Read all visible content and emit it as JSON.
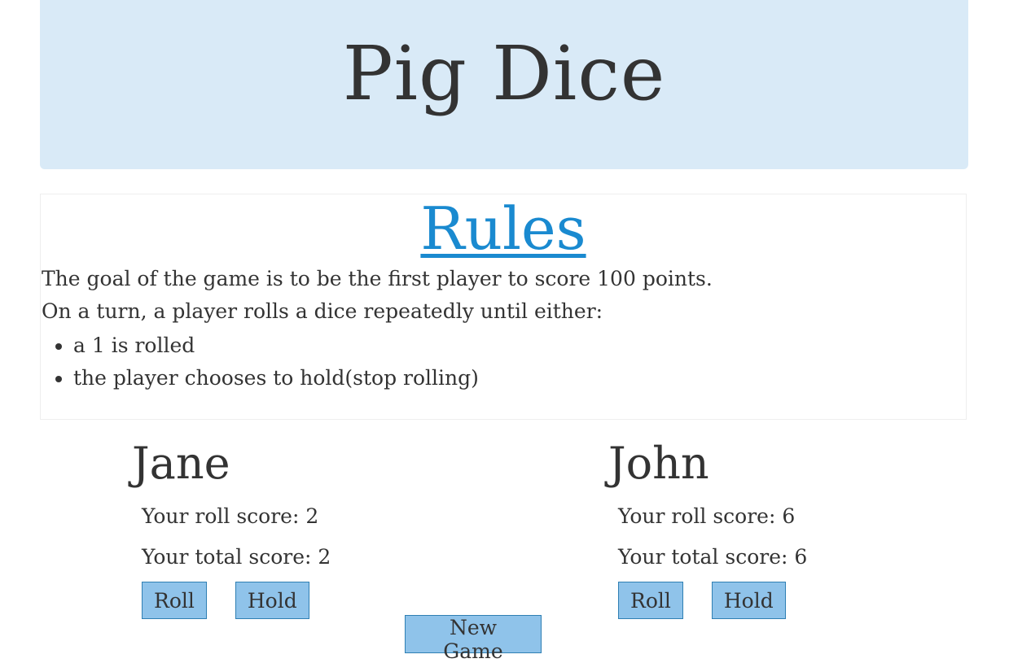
{
  "header": {
    "title": "Pig Dice"
  },
  "rules": {
    "title": "Rules",
    "line1": "The goal of the game is to be the first player to score 100 points.",
    "line2": "On a turn, a player rolls a dice repeatedly until either:",
    "items": [
      "a 1 is rolled",
      "the player chooses to hold(stop rolling)"
    ]
  },
  "players": [
    {
      "name": "Jane",
      "roll_label": "Your roll score: ",
      "roll_score": "2",
      "total_label": "Your total score: ",
      "total_score": "2",
      "roll_button": "Roll",
      "hold_button": "Hold"
    },
    {
      "name": "John",
      "roll_label": "Your roll score: ",
      "roll_score": "6",
      "total_label": "Your total score: ",
      "total_score": "6",
      "roll_button": "Roll",
      "hold_button": "Hold"
    }
  ],
  "controls": {
    "new_game": "New Game"
  },
  "colors": {
    "header_bg": "#d9eaf7",
    "link": "#1a8ad0",
    "button_bg": "#8fc3ea",
    "button_border": "#2f7fb3"
  }
}
